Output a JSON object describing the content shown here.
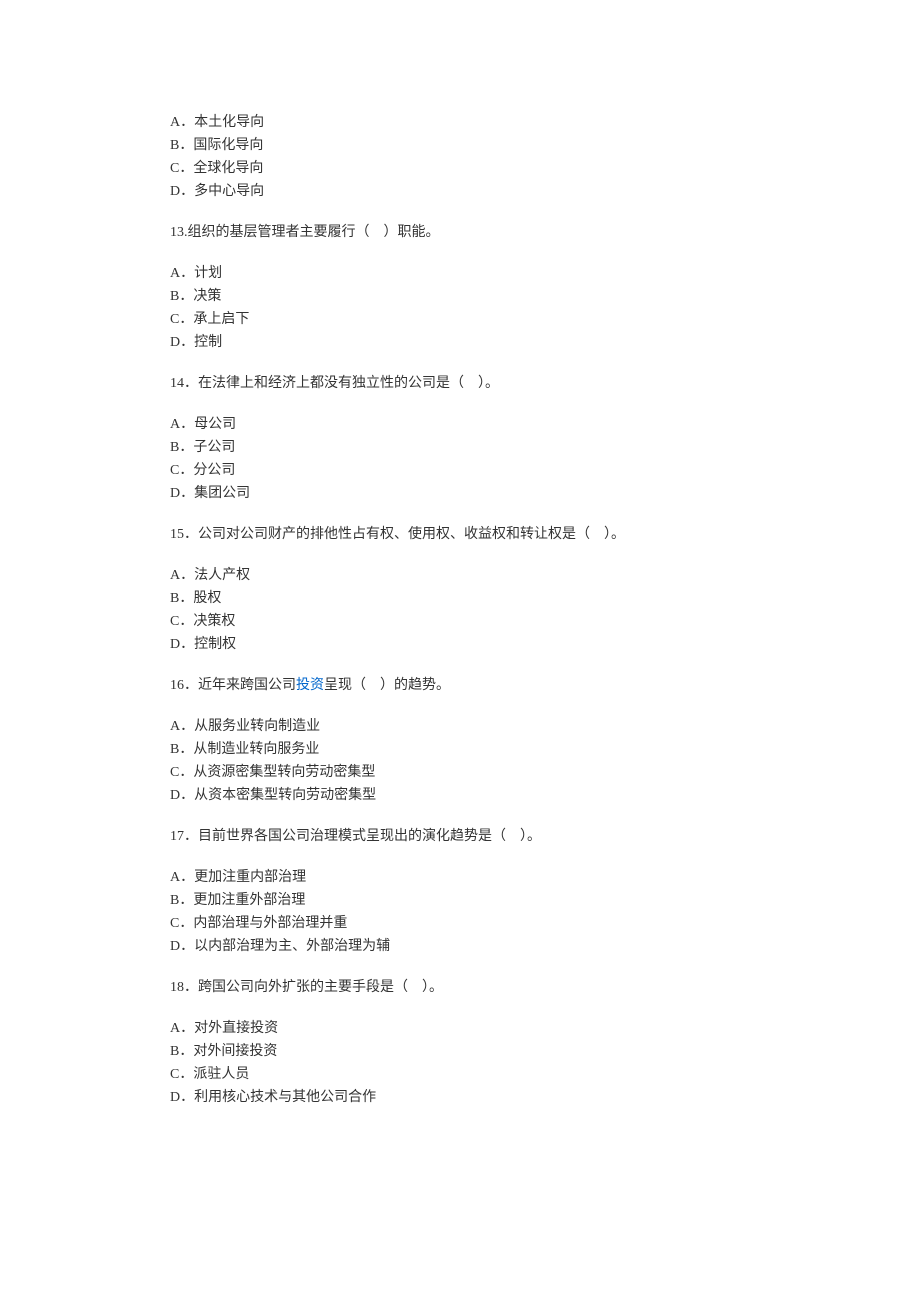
{
  "q12": {
    "options": {
      "a": "A．本土化导向",
      "b": "B．国际化导向",
      "c": "C．全球化导向",
      "d": "D．多中心导向"
    }
  },
  "q13": {
    "text": "13.组织的基层管理者主要履行（　）职能。",
    "options": {
      "a": "A．计划",
      "b": "B．决策",
      "c": "C．承上启下",
      "d": "D．控制"
    }
  },
  "q14": {
    "text": "14．在法律上和经济上都没有独立性的公司是（　）。",
    "options": {
      "a": "A．母公司",
      "b": "B．子公司",
      "c": "C．分公司",
      "d": "D．集团公司"
    }
  },
  "q15": {
    "text": "15．公司对公司财产的排他性占有权、使用权、收益权和转让权是（　）。",
    "options": {
      "a": "A．法人产权",
      "b": "B．股权",
      "c": "C．决策权",
      "d": "D．控制权"
    }
  },
  "q16": {
    "text_before": "16．近年来跨国公司",
    "link": "投资",
    "text_after": "呈现（　）的趋势。",
    "options": {
      "a": "A．从服务业转向制造业",
      "b": "B．从制造业转向服务业",
      "c": "C．从资源密集型转向劳动密集型",
      "d": "D．从资本密集型转向劳动密集型"
    }
  },
  "q17": {
    "text": "17．目前世界各国公司治理模式呈现出的演化趋势是（　）。",
    "options": {
      "a": "A．更加注重内部治理",
      "b": "B．更加注重外部治理",
      "c": "C．内部治理与外部治理并重",
      "d": "D．以内部治理为主、外部治理为辅"
    }
  },
  "q18": {
    "text": "18．跨国公司向外扩张的主要手段是（　）。",
    "options": {
      "a": "A．对外直接投资",
      "b": "B．对外间接投资",
      "c": "C．派驻人员",
      "d": "D．利用核心技术与其他公司合作"
    }
  }
}
